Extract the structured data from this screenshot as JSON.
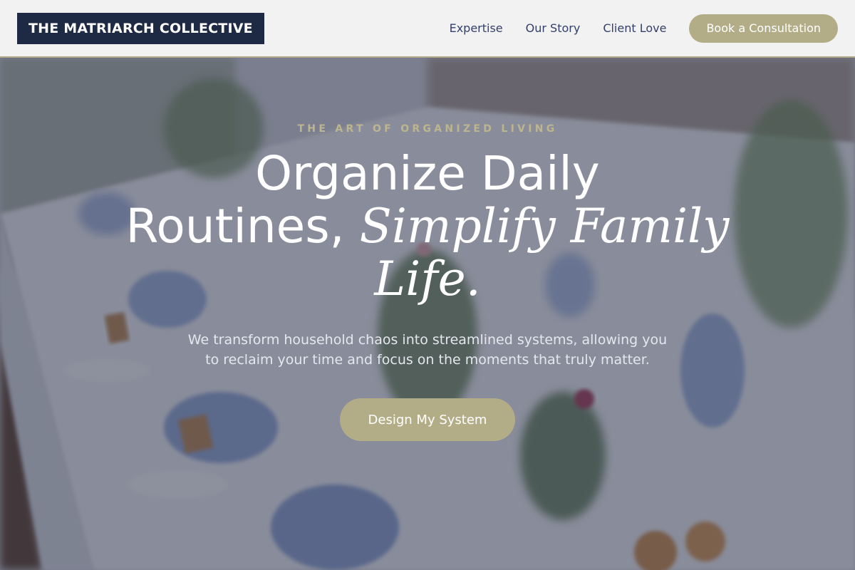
{
  "header": {
    "logo_text": "THE MATRIARCH COLLECTIVE",
    "nav": [
      {
        "label": "Expertise"
      },
      {
        "label": "Our Story"
      },
      {
        "label": "Client Love"
      }
    ],
    "cta_label": "Book a Consultation"
  },
  "hero": {
    "eyebrow": "THE ART OF ORGANIZED LIVING",
    "headline_line1": "Organize Daily",
    "headline_line2_plain": "Routines, ",
    "headline_line2_accent": "Simplify Family",
    "headline_line3_accent": "Life.",
    "subtext": "We transform household chaos into streamlined systems, allowing you to reclaim your time and focus on the moments that truly matter.",
    "cta_label": "Design My System"
  },
  "colors": {
    "brand_navy": "#1e2a44",
    "accent_khaki": "#b3ad87",
    "nav_text": "#34406a",
    "overlay": "rgba(44,50,72,0.52)"
  },
  "background_image": "banquet-table-photo"
}
